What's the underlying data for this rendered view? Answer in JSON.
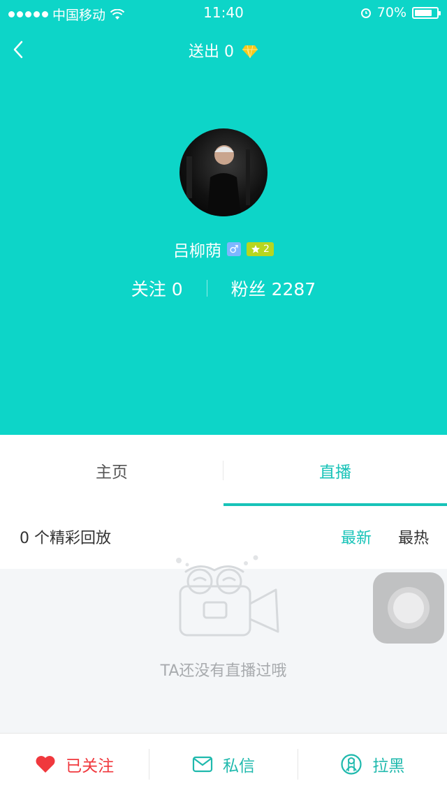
{
  "status_bar": {
    "carrier": "中国移动",
    "time": "11:40",
    "battery": "70%",
    "battery_level": 0.7
  },
  "nav": {
    "title": "送出 0"
  },
  "profile": {
    "name": "吕柳荫",
    "gender_symbol": "♂",
    "level": "2",
    "following_label": "关注 0",
    "fans_label": "粉丝 2287"
  },
  "tabs": {
    "items": [
      {
        "label": "主页",
        "active": false
      },
      {
        "label": "直播",
        "active": true
      }
    ]
  },
  "replay": {
    "count_label": "0 个精彩回放",
    "sort_newest": "最新",
    "sort_hottest": "最热"
  },
  "empty_state": {
    "message": "TA还没有直播过哦"
  },
  "bottom_bar": {
    "follow_label": "已关注",
    "message_label": "私信",
    "block_label": "拉黑"
  },
  "colors": {
    "accent": "#0dd5c8",
    "tab_active": "#18c3b8",
    "follow_red": "#f0383d",
    "level_badge": "#b7d61f",
    "gender_badge": "#7eb6ff"
  },
  "icons": {
    "back": "chevron-left-icon",
    "diamond": "diamond-icon",
    "follow": "heart-icon",
    "message": "envelope-icon",
    "block": "block-icon"
  }
}
